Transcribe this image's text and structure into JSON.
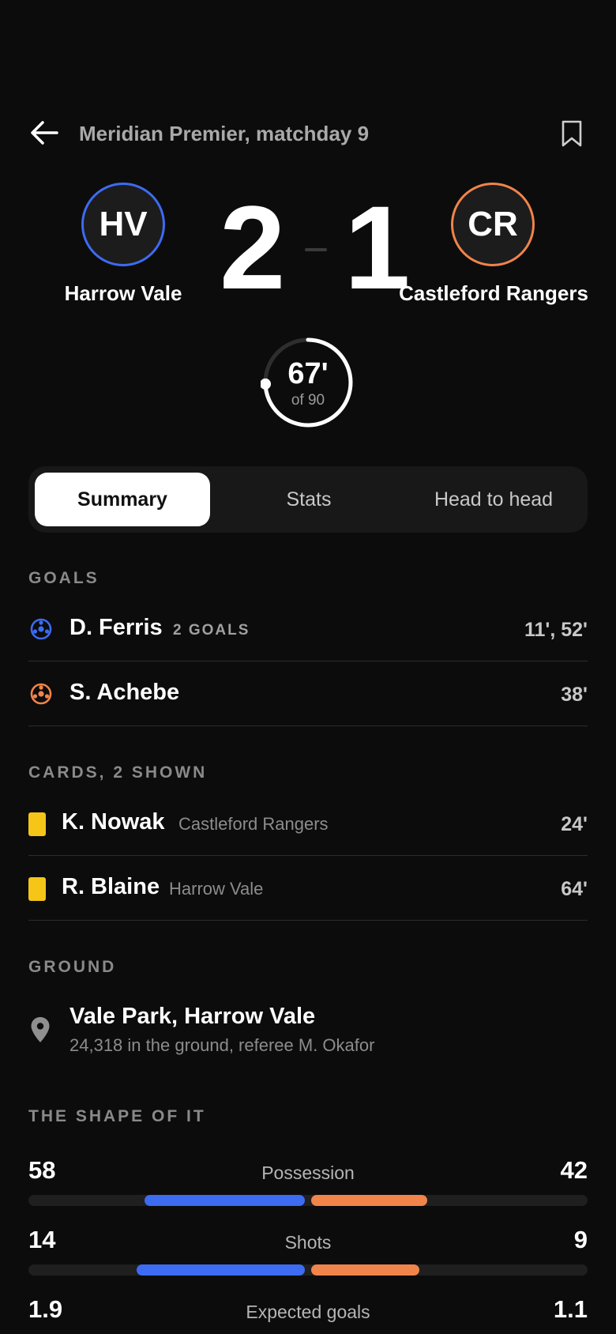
{
  "header": {
    "crumb": "Meridian Premier, matchday 9"
  },
  "match": {
    "home": {
      "crest": "HV",
      "name": "Harrow Vale",
      "score": "2",
      "color": "#3d6bf2"
    },
    "away": {
      "crest": "CR",
      "name": "Castleford Rangers",
      "score": "1",
      "color": "#f0844a"
    },
    "clock": {
      "minute": "67'",
      "of": "of 90",
      "progress": 0.7444
    }
  },
  "tabs": [
    {
      "label": "Summary",
      "active": true
    },
    {
      "label": "Stats",
      "active": false
    },
    {
      "label": "Head to head",
      "active": false
    }
  ],
  "goals": {
    "title": "GOALS",
    "items": [
      {
        "player": "D. Ferris",
        "tag": "2 GOALS",
        "minutes": "11', 52'",
        "team": "home"
      },
      {
        "player": "S. Achebe",
        "tag": "",
        "minutes": "38'",
        "team": "away"
      }
    ]
  },
  "cards": {
    "title": "CARDS, 2 SHOWN",
    "items": [
      {
        "player": "K. Nowak",
        "team": "Castleford Rangers",
        "minute": "24'",
        "color": "#f5c518"
      },
      {
        "player": "R. Blaine",
        "team": "Harrow Vale",
        "minute": "64'",
        "color": "#f5c518"
      }
    ]
  },
  "ground": {
    "title": "GROUND",
    "venue": "Vale Park, Harrow Vale",
    "detail": "24,318 in the ground, referee M. Okafor"
  },
  "shape": {
    "title": "THE SHAPE OF IT",
    "stats": [
      {
        "label": "Possession",
        "home": "58",
        "away": "42",
        "home_value": 58,
        "away_value": 42
      },
      {
        "label": "Shots",
        "home": "14",
        "away": "9",
        "home_value": 14,
        "away_value": 9
      },
      {
        "label": "Expected goals",
        "home": "1.9",
        "away": "1.1",
        "home_value": 1.9,
        "away_value": 1.1
      }
    ]
  }
}
